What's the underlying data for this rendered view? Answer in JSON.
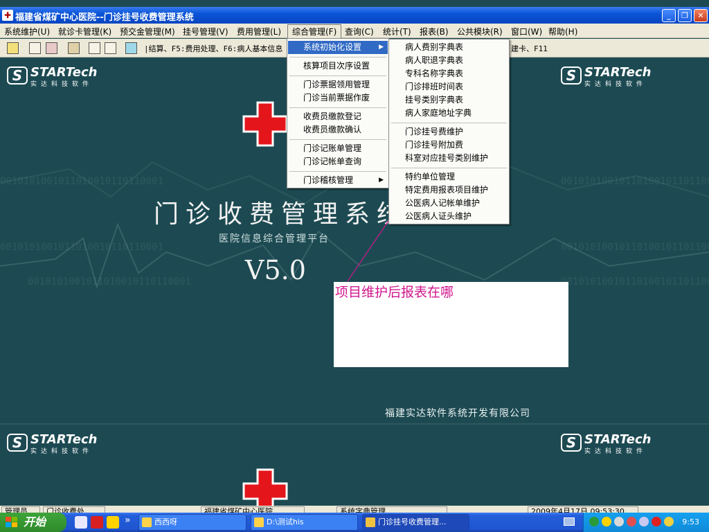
{
  "window": {
    "title": "福建省煤矿中心医院--门诊挂号收费管理系统",
    "minimize": "_",
    "maximize": "❐",
    "close": "✕"
  },
  "menubar": [
    "系统维护(U)",
    "就诊卡管理(K)",
    "预交金管理(M)",
    "挂号管理(V)",
    "费用管理(L)",
    "综合管理(F)",
    "查询(C)",
    "统计(T)",
    "报表(B)",
    "公共模块(R)",
    "窗口(W)",
    "帮助(H)"
  ],
  "toolbar": {
    "hint": "|结算、F5:费用处理、F6:病人基本信息",
    "hint_tail": "建卡、F11"
  },
  "menu_level1": {
    "items": [
      {
        "label": "系统初始化设置",
        "submenu": true
      },
      {
        "label": "核算项目次序设置"
      },
      {
        "label": "门诊票据领用管理"
      },
      {
        "label": "门诊当前票据作废"
      },
      {
        "label": "收费员缴款登记"
      },
      {
        "label": "收费员缴款确认"
      },
      {
        "label": "门诊记账单管理"
      },
      {
        "label": "门诊记帐单查询"
      },
      {
        "label": "门诊稽核管理",
        "submenu": true
      }
    ]
  },
  "menu_level2": {
    "items": [
      "病人费别字典表",
      "病人职退字典表",
      "专科名称字典表",
      "门诊排班时间表",
      "挂号类别字典表",
      "病人家庭地址字典",
      "门诊挂号费维护",
      "门诊挂号附加费",
      "科室对应挂号类别维护",
      "特约单位管理",
      "特定费用报表项目维护",
      "公医病人记帐单维护",
      "公医病人证头维护"
    ]
  },
  "splash": {
    "brand": "STARTech",
    "brand_sub": "实达科技软件",
    "title": "门诊收费管理系统",
    "subtitle": "医院信息综合管理平台",
    "version": "V5.0",
    "company": "福建实达软件系统开发有限公司",
    "binary_text": "0010101001011010010110110001"
  },
  "note": "项目维护后报表在哪",
  "statusbar": [
    "管理员",
    "门诊收费处",
    "福建省煤矿中心医院",
    "系统字典管理",
    "2009年4月17日 09:53:30"
  ],
  "taskbar": {
    "start": "开始",
    "tasks": [
      "西西呀",
      "D:\\测试his",
      "门诊挂号收费管理..."
    ],
    "clock": "9:53",
    "quicklaunch_more": "»"
  },
  "colors": {
    "background": "#1d4a52",
    "highlight": "#316ac5",
    "annotation": "#d0168c",
    "redcross": "#e4161c"
  }
}
